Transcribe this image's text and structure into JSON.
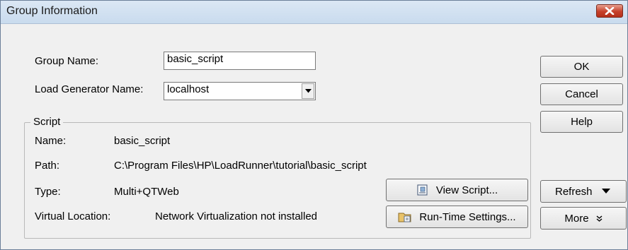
{
  "window": {
    "title": "Group Information"
  },
  "fields": {
    "group_name_label": "Group Name:",
    "group_name_value": "basic_script",
    "load_generator_label": "Load Generator Name:",
    "load_generator_value": "localhost"
  },
  "script": {
    "section_title": "Script",
    "name_label": "Name:",
    "name_value": "basic_script",
    "path_label": "Path:",
    "path_value": "C:\\Program Files\\HP\\LoadRunner\\tutorial\\basic_script",
    "type_label": "Type:",
    "type_value": "Multi+QTWeb",
    "virtual_location_label": "Virtual Location:",
    "virtual_location_value": "Network Virtualization not installed",
    "view_script_label": "View Script...",
    "runtime_settings_label": "Run-Time Settings..."
  },
  "buttons": {
    "ok": "OK",
    "cancel": "Cancel",
    "help": "Help",
    "refresh": "Refresh",
    "more": "More"
  },
  "icons": {
    "close": "close-icon",
    "dropdown": "chevron-down-icon",
    "view_script": "script-document-icon",
    "runtime_settings": "settings-folder-icon"
  }
}
